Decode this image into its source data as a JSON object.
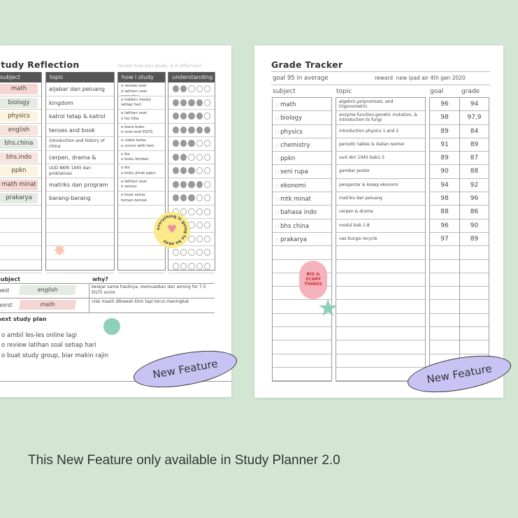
{
  "reflection": {
    "title": "Study Reflection",
    "hint": "review how you study, is it effective?",
    "headers": [
      "subject",
      "topic",
      "how i study",
      "understanding"
    ],
    "rows": [
      {
        "subject": "math",
        "color": "#f6d6d2",
        "topic": "aljabar dan peluang",
        "how": "o review soal\no latihan soal everyday",
        "score": 2
      },
      {
        "subject": "biology",
        "color": "#e4ebe2",
        "topic": "kingdom",
        "how": "o hafalin modul\nsetiap hari",
        "score": 4
      },
      {
        "subject": "physics",
        "color": "#fbf3dd",
        "topic": "katrol tetap & katrol bebas",
        "how": "o latihan soal\no les tiba",
        "score": 4
      },
      {
        "subject": "english",
        "color": "#f8e2dc",
        "topic": "tenses and book review",
        "how": "o baca buku\no soal-soal EILTS",
        "score": 5
      },
      {
        "subject": "bhs.china",
        "color": "#e4ebe2",
        "topic": "introduction and history of china",
        "how": "o video kelas\no convo with fam",
        "score": 3
      },
      {
        "subject": "bhs.indo",
        "color": "#f8e2dc",
        "topic": "cerpen, drama & review buku",
        "how": "o lks\no buku bimbel",
        "score": 2
      },
      {
        "subject": "ppkn",
        "color": "#fbf3dd",
        "topic": "UUD NKRI 1945 dan proklamasi",
        "how": "o lks\no buku jimat ppkn",
        "score": 3
      },
      {
        "subject": "math minat",
        "color": "#f6d6d2",
        "topic": "matriks dan program linear",
        "how": "o latihan soal\no zenius",
        "score": 4
      },
      {
        "subject": "prakarya",
        "color": "#e4ebe2",
        "topic": "barang-barang recycle",
        "how": "o buat sama\nteman-teman",
        "score": 3
      }
    ],
    "best_worst": {
      "subject_label": "subject",
      "why_label": "why?",
      "rows": [
        {
          "label": "best",
          "subject": "english",
          "why": "belajar sama hasilnya, memuaskan dan aiming for 7.5 EILTS score",
          "color": "#e4ebe2"
        },
        {
          "label": "worst",
          "subject": "math",
          "why": "nilai masih dibawah kkm tapi terus meningkat",
          "color": "#f6d6d2"
        }
      ]
    },
    "plan_title": "next study plan",
    "plan": [
      "o ambil les-les online lagi",
      "o review latihan soal setiap hari",
      "o buat study group, biar makin rajin"
    ],
    "sticker": "everything is going to be okay"
  },
  "tracker": {
    "title": "Grade Tracker",
    "goal_label": "goal",
    "goal_value": "95 in average",
    "reward_label": "reward",
    "reward_value": "new ipad air 4th gen 2020",
    "headers": [
      "subject",
      "topic",
      "goal",
      "grade"
    ],
    "rows": [
      {
        "subject": "math",
        "topic": "algebric,polynomials, and trigonometric",
        "goal": "96",
        "grade": "94"
      },
      {
        "subject": "biology",
        "topic": "enzyme function,genetic mutation, & introduction to fungi",
        "goal": "98",
        "grade": "97,9"
      },
      {
        "subject": "physics",
        "topic": "introduction physics 1 and 2",
        "goal": "89",
        "grade": "84"
      },
      {
        "subject": "chemistry",
        "topic": "periodic tables & ikatan isomer",
        "goal": "91",
        "grade": "89"
      },
      {
        "subject": "ppkn",
        "topic": "uud nkri 1945 bab1-3",
        "goal": "89",
        "grade": "87"
      },
      {
        "subject": "seni rupa",
        "topic": "gambar poster",
        "goal": "90",
        "grade": "88"
      },
      {
        "subject": "ekonomi",
        "topic": "pengantar & kosep ekonomi",
        "goal": "94",
        "grade": "92"
      },
      {
        "subject": "mtk minat",
        "topic": "matriks dan peluang",
        "goal": "98",
        "grade": "96"
      },
      {
        "subject": "bahasa indo",
        "topic": "cerpen & drama",
        "goal": "88",
        "grade": "86"
      },
      {
        "subject": "bhs china",
        "topic": "modul bab 1-8",
        "goal": "96",
        "grade": "90"
      },
      {
        "subject": "prakarya",
        "topic": "vas bunga recycle",
        "goal": "97",
        "grade": "89"
      }
    ],
    "sticker": "BIG & SCARY THINGS"
  },
  "badge": "New Feature",
  "caption": "This New Feature only available in Study Planner 2.0"
}
